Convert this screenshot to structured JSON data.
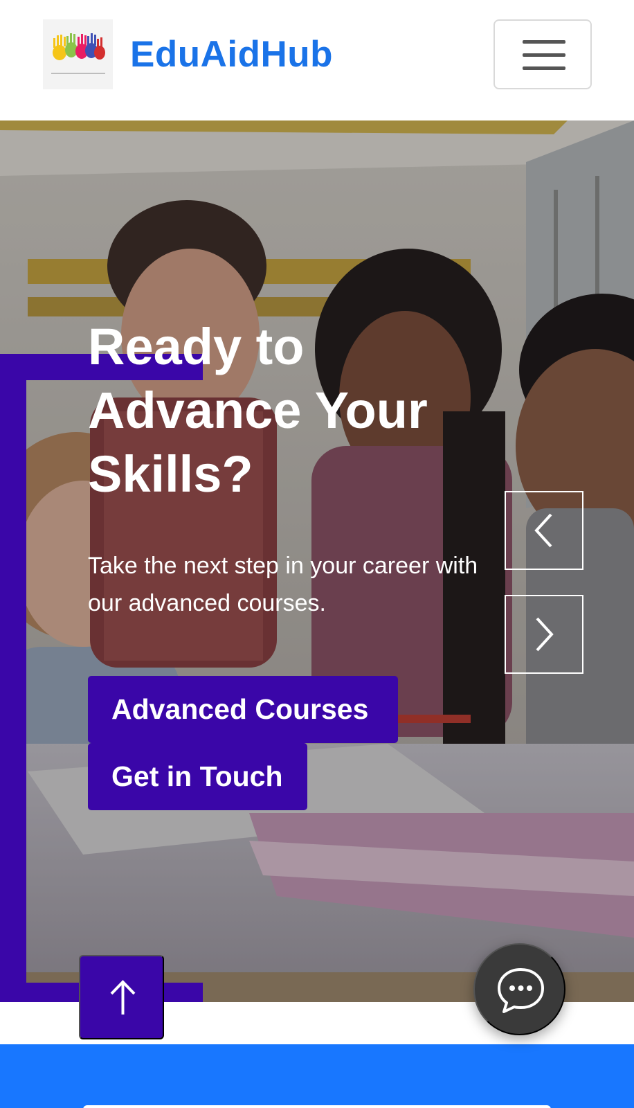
{
  "header": {
    "brand": "EduAidHub",
    "logo_icon": "handprints-logo",
    "menu_icon": "hamburger-menu-icon"
  },
  "hero": {
    "headline": "Ready to Advance Your Skills?",
    "subtext": "Take the next step in your career with our advanced courses.",
    "primary_cta": "Advanced Courses",
    "secondary_cta": "Get in Touch",
    "prev_icon": "chevron-left-icon",
    "next_icon": "chevron-right-icon"
  },
  "floating": {
    "back_to_top_icon": "arrow-up-icon",
    "chat_icon": "chat-bubble-icon"
  },
  "colors": {
    "brand_blue": "#1a73e8",
    "accent_purple": "#3a06a8",
    "band_blue": "#1877ff",
    "chat_dark": "#3a3a3a"
  }
}
